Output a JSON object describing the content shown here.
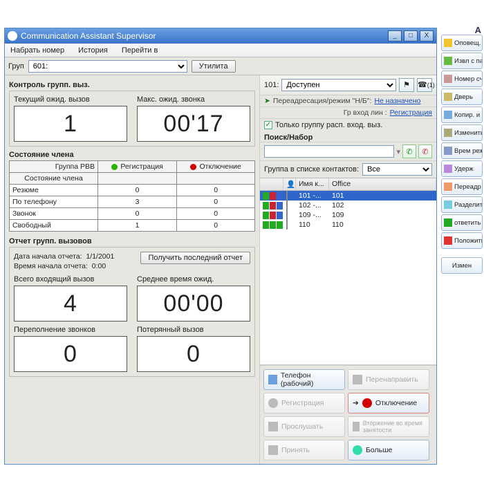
{
  "title": "Communication Assistant Supervisor",
  "menu": {
    "dial": "Набрать номер",
    "history": "История",
    "goto": "Перейти в"
  },
  "toolbar": {
    "group_lbl": "Груп",
    "group_val": "601:",
    "utility": "Утилита"
  },
  "left": {
    "ctrl_title": "Контроль групп. выз.",
    "cur_wait": {
      "cap": "Текущий ожид. вызов",
      "val": "1"
    },
    "max_wait": {
      "cap": "Макс. ожид. звонка",
      "val": "00'17"
    },
    "member_title": "Состояние члена",
    "tbl": {
      "h1a": "Группа РВВ",
      "h1b": "Состояние члена",
      "h2": "Регистрация",
      "h3": "Отключение",
      "rows": [
        {
          "name": "Резюме",
          "login": "0",
          "logout": "0"
        },
        {
          "name": "По телефону",
          "login": "3",
          "logout": "0"
        },
        {
          "name": "Звонок",
          "login": "0",
          "logout": "0"
        },
        {
          "name": "Свободный",
          "login": "1",
          "logout": "0"
        }
      ]
    },
    "rep_title": "Отчет групп. вызовов",
    "rep_date_lbl": "Дата начала отчета:",
    "rep_date": "1/1/2001",
    "rep_time_lbl": "Время начала отчета:",
    "rep_time": "0:00",
    "rep_btn": "Получить последний отчет",
    "tot_in": {
      "cap": "Всего входящий вызов",
      "val": "4"
    },
    "avg_w": {
      "cap": "Среднее время ожид.",
      "val": "00'00"
    },
    "overflow": {
      "cap": "Переполнение звонков",
      "val": "0"
    },
    "lost": {
      "cap": "Потерянный вызов",
      "val": "0"
    }
  },
  "right": {
    "ext": "101:",
    "status": "Доступен",
    "iconcount": "(1)",
    "fwd_lbl": "Переадресация/режим \"Н/Б\":",
    "fwd_val": "Не назначено",
    "grline": "Гр вход лин : ",
    "grlink": "Регистрация",
    "only_grp": "Только группу расп. вход. выз.",
    "search_lbl": "Поиск/Набор",
    "contacts_lbl": "Группа в списке контактов:",
    "contacts_val": "Все",
    "cols": {
      "c1": "",
      "c2": "",
      "c3": "Имя к...",
      "c4": "Office"
    },
    "rows": [
      {
        "n": "101",
        "d": "-...",
        "o": "101",
        "sel": true
      },
      {
        "n": "102",
        "d": "-...",
        "o": "102"
      },
      {
        "n": "109",
        "d": "-...",
        "o": "109"
      },
      {
        "n": "110",
        "d": "",
        "o": "110"
      }
    ],
    "actions": {
      "phone": "Телефон (рабочий)",
      "redirect": "Перенаправить",
      "login": "Регистрация",
      "logout": "Отключение",
      "listen": "Прослушать",
      "barge": "Вторжение во время занятости",
      "take": "Принять",
      "more": "Больше"
    }
  },
  "palette": {
    "head": "A",
    "items": [
      "Оповещ. (гибк",
      "Извл с парк",
      "Номер счета",
      "Дверь",
      "Копир. и наб",
      "Изменить TRS",
      "Врем режим",
      "Удерж",
      "Переадр",
      "Разделить",
      "ответить",
      "Положить тру"
    ],
    "edit": "Измен"
  }
}
